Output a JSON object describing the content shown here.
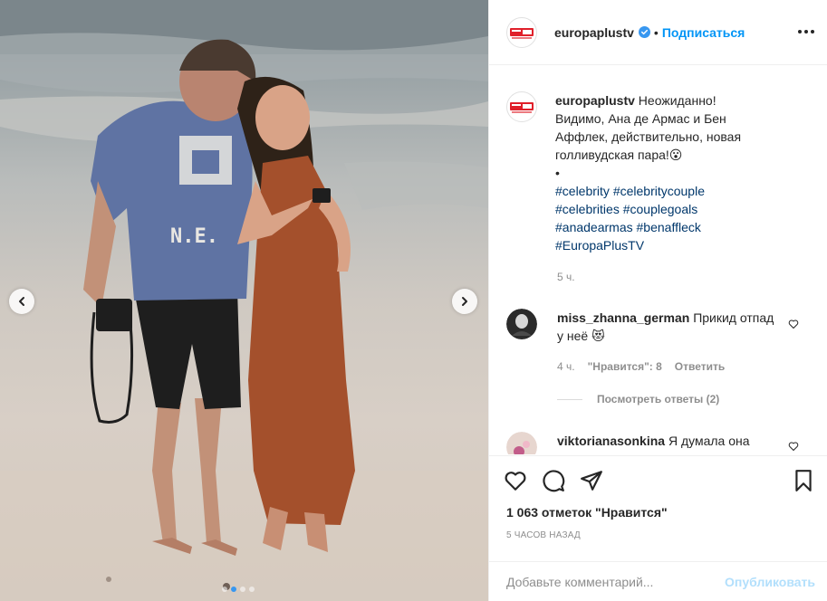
{
  "post": {
    "username": "europaplustv",
    "follow_label": "Подписаться",
    "separator": "•",
    "caption": {
      "text": "Неожиданно! Видимо, Ана де Армас и Бен Аффлек, действительно, новая голливудская пара!😮",
      "bullet": "•",
      "hashtags": [
        "#celebrity",
        "#celebritycouple",
        "#celebrities",
        "#couplegoals",
        "#anadearmas",
        "#benaffleck",
        "#EuropaPlusTV"
      ],
      "time": "5 ч."
    },
    "photo_caption_shirt": "N.E.",
    "carousel": {
      "total": 4,
      "active": 2
    },
    "comments": [
      {
        "username": "miss_zhanna_german",
        "text": "Прикид отпад у неё 😻",
        "time": "4 ч.",
        "likes": "\"Нравится\": 8",
        "reply": "Ответить"
      },
      {
        "username": "viktorianasonkina",
        "text": "Я думала она"
      }
    ],
    "view_replies": "Посмотреть ответы (2)",
    "likes_count": "1 063 отметок \"Нравится\"",
    "time_ago": "5 ЧАСОВ НАЗАД",
    "add_comment_placeholder": "Добавьте комментарий...",
    "publish_label": "Опубликовать"
  },
  "colors": {
    "accent": "#0095f6",
    "hashtag": "#00376b",
    "muted": "#8e8e8e"
  },
  "icons": [
    "verified-icon",
    "more-icon",
    "heart-icon",
    "comment-icon",
    "share-icon",
    "bookmark-icon",
    "chevron-left-icon",
    "chevron-right-icon"
  ]
}
